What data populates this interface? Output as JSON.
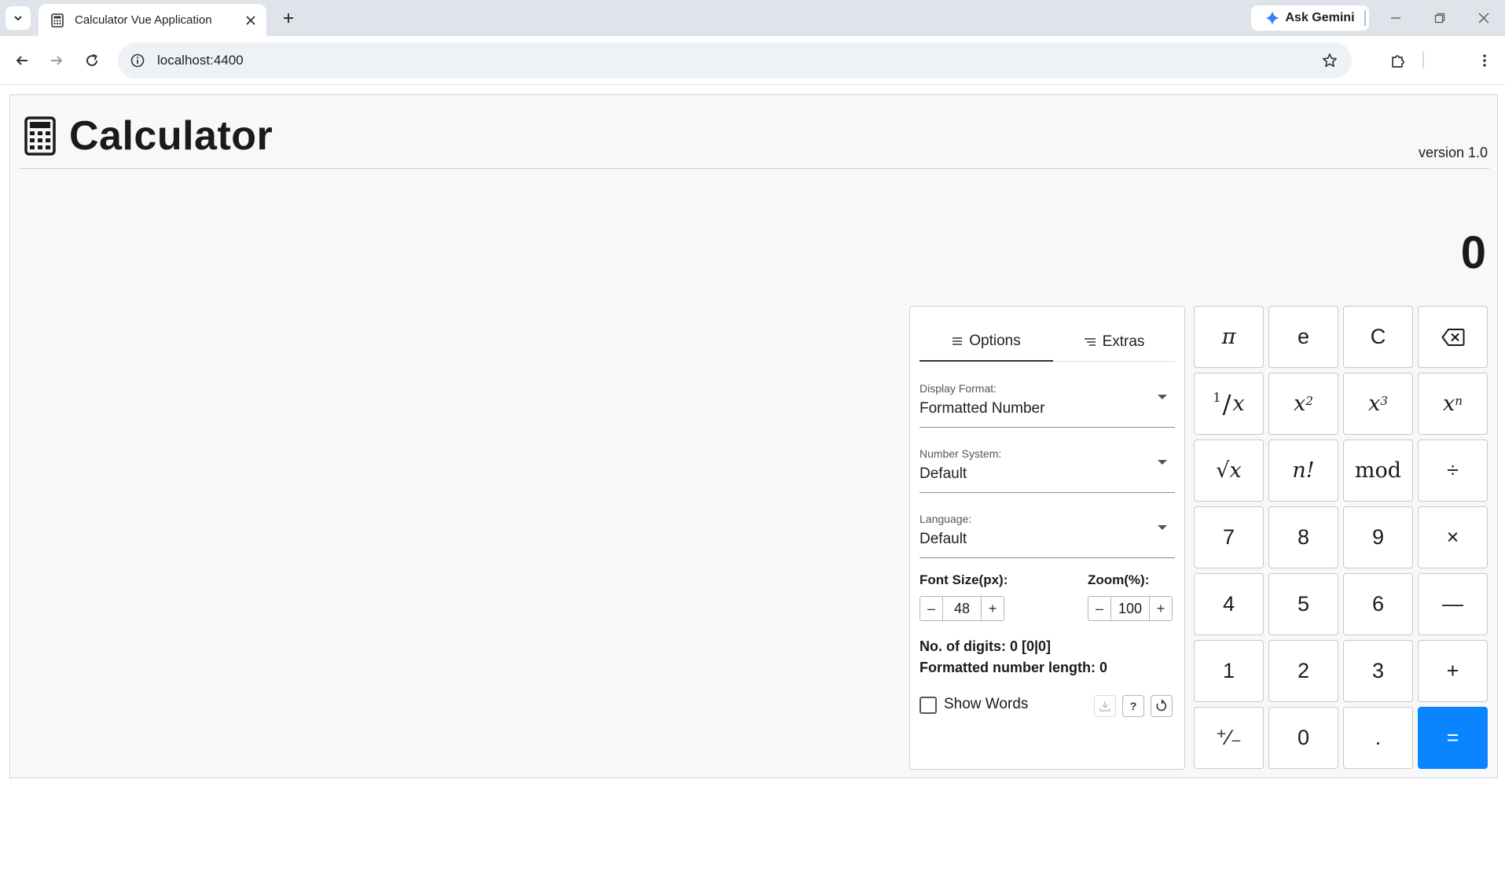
{
  "browser": {
    "tab_title": "Calculator Vue Application",
    "gemini_label": "Ask Gemini",
    "url": "localhost:4400",
    "colors": {
      "tabbar": "#dfe3ea",
      "omnibox": "#eef1f5"
    }
  },
  "header": {
    "title": "Calculator",
    "version": "version 1.0",
    "logo_icon": "calculator-icon"
  },
  "display": {
    "value": "0"
  },
  "panel": {
    "tabs": [
      {
        "label": "Options",
        "icon": "menu-lines-icon",
        "active": true
      },
      {
        "label": "Extras",
        "icon": "indent-lines-icon",
        "active": false
      }
    ],
    "fields": [
      {
        "label": "Display Format:",
        "value": "Formatted Number"
      },
      {
        "label": "Number System:",
        "value": "Default"
      },
      {
        "label": "Language:",
        "value": "Default"
      }
    ],
    "font_size": {
      "label": "Font Size(px):",
      "value": "48",
      "minus": "–",
      "plus": "+"
    },
    "zoom": {
      "label": "Zoom(%):",
      "value": "100",
      "minus": "–",
      "plus": "+"
    },
    "digits_info": "No. of digits: 0 [0|0]",
    "length_info": "Formatted number length: 0",
    "show_words": {
      "label": "Show Words",
      "checked": false
    },
    "help_label": "?"
  },
  "keypad": {
    "keys": [
      {
        "name": "pi-key",
        "label": "π",
        "style": "math"
      },
      {
        "name": "e-key",
        "label": "e",
        "style": "plain"
      },
      {
        "name": "clear-key",
        "label": "C",
        "style": "plain"
      },
      {
        "name": "backspace-key",
        "label": "",
        "style": "icon"
      },
      {
        "name": "reciprocal-key",
        "label": "1/x",
        "style": "frac"
      },
      {
        "name": "square-key",
        "label": "x2",
        "style": "pow",
        "base": "x",
        "exp": "2"
      },
      {
        "name": "cube-key",
        "label": "x3",
        "style": "pow",
        "base": "x",
        "exp": "3"
      },
      {
        "name": "power-key",
        "label": "xn",
        "style": "pow",
        "base": "x",
        "exp": "n"
      },
      {
        "name": "sqrt-key",
        "label": "√x",
        "style": "math"
      },
      {
        "name": "factorial-key",
        "label": "n!",
        "style": "math"
      },
      {
        "name": "mod-key",
        "label": "mod",
        "style": "serif"
      },
      {
        "name": "divide-key",
        "label": "÷",
        "style": "plain"
      },
      {
        "name": "seven-key",
        "label": "7",
        "style": "plain"
      },
      {
        "name": "eight-key",
        "label": "8",
        "style": "plain"
      },
      {
        "name": "nine-key",
        "label": "9",
        "style": "plain"
      },
      {
        "name": "multiply-key",
        "label": "×",
        "style": "plain"
      },
      {
        "name": "four-key",
        "label": "4",
        "style": "plain"
      },
      {
        "name": "five-key",
        "label": "5",
        "style": "plain"
      },
      {
        "name": "six-key",
        "label": "6",
        "style": "plain"
      },
      {
        "name": "minus-key",
        "label": "—",
        "style": "plain"
      },
      {
        "name": "one-key",
        "label": "1",
        "style": "plain"
      },
      {
        "name": "two-key",
        "label": "2",
        "style": "plain"
      },
      {
        "name": "three-key",
        "label": "3",
        "style": "plain"
      },
      {
        "name": "plus-key",
        "label": "+",
        "style": "plain"
      },
      {
        "name": "negate-key",
        "label": "⁺∕₋",
        "style": "plain"
      },
      {
        "name": "zero-key",
        "label": "0",
        "style": "plain"
      },
      {
        "name": "decimal-key",
        "label": ".",
        "style": "plain"
      },
      {
        "name": "equals-key",
        "label": "=",
        "style": "equals"
      }
    ],
    "colors": {
      "equals": "#0a84ff",
      "key_bg": "#ffffff"
    }
  }
}
